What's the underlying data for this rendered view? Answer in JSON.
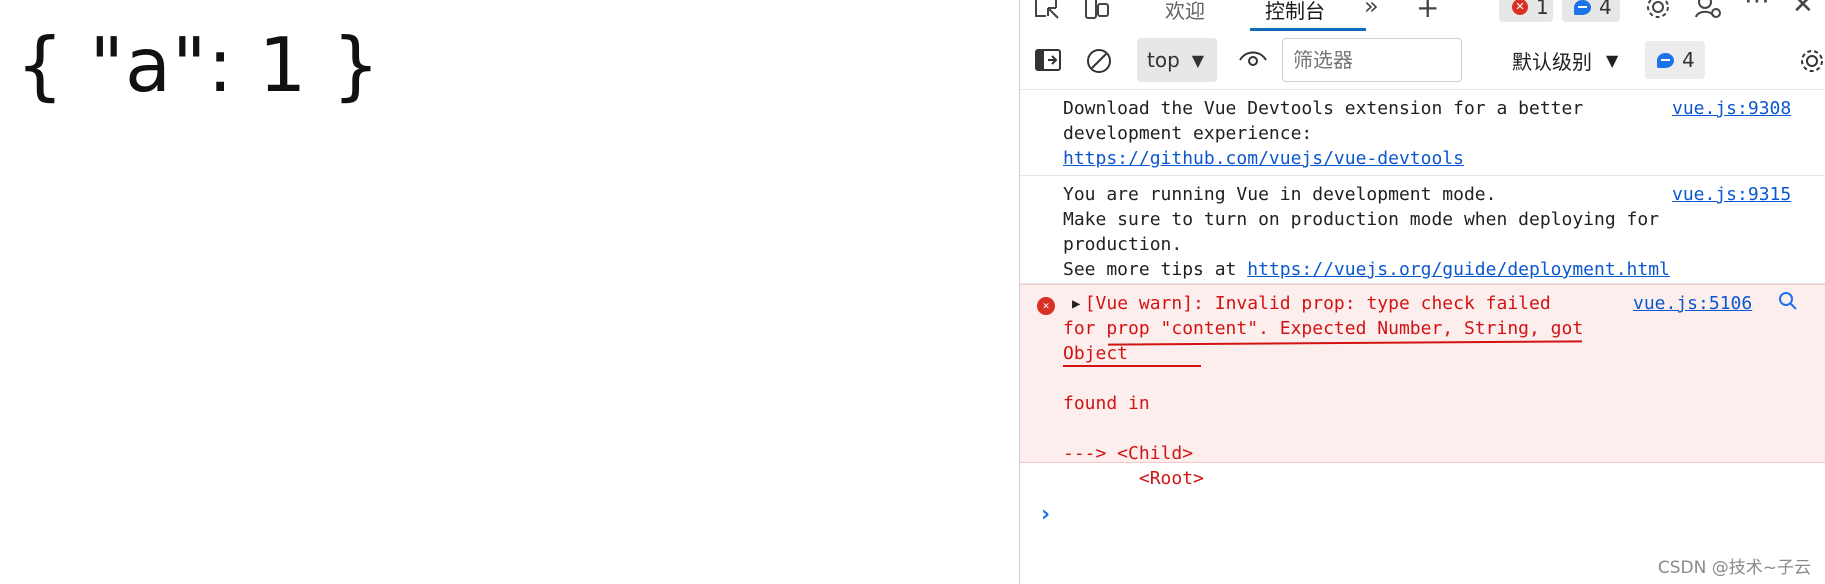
{
  "page": {
    "output_text": "{ \"a\": 1 }"
  },
  "devtools": {
    "tabs": [
      "欢迎",
      "控制台"
    ],
    "active_tab": "控制台",
    "error_count": "1",
    "message_count": "4",
    "toolbar": {
      "context": "top",
      "filter_placeholder": "筛选器",
      "level": "默认级别",
      "issues_count": "4"
    },
    "messages": [
      {
        "lines": [
          "Download the Vue Devtools extension for a better",
          "development experience:"
        ],
        "link": "https://github.com/vuejs/vue-devtools",
        "source": "vue.js:9308"
      },
      {
        "lines": [
          "You are running Vue in development mode.",
          "Make sure to turn on production mode when deploying for",
          "production."
        ],
        "tail_prefix": "See more tips at ",
        "link": "https://vuejs.org/guide/deployment.html",
        "source": "vue.js:9315"
      }
    ],
    "error": {
      "line1": "[Vue warn]: Invalid prop: type check failed",
      "line2": "for prop \"content\". Expected Number, String, got",
      "line3": "Object",
      "line4": "found in",
      "line5": "---> <Child>",
      "line6": "       <Root>",
      "source": "vue.js:5106"
    },
    "prompt": "›"
  },
  "watermark": "CSDN @技术~子云",
  "colors": {
    "accent": "#0f6cbd",
    "error_red": "#d21313",
    "error_bg": "#fdeeee",
    "link": "#0b57d0"
  }
}
